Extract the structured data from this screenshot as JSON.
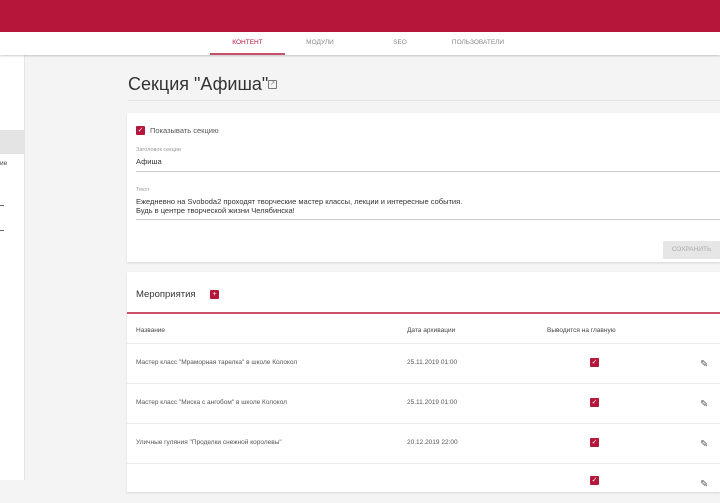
{
  "nav": {
    "tabs": [
      {
        "label": "КОНТЕНТ",
        "active": true
      },
      {
        "label": "МОДУЛИ"
      },
      {
        "label": "SEO"
      },
      {
        "label": "ПОЛЬЗОВАТЕЛИ"
      }
    ]
  },
  "sidebar": {
    "partial_label": "ие"
  },
  "page": {
    "title": "Секция \"Афиша\""
  },
  "section_form": {
    "show_section_label": "Показывать секцию",
    "show_section_checked": true,
    "title_label": "Заголовок секции",
    "title_value": "Афиша",
    "text_label": "Текст",
    "text_line1": "Ежедневно на Svoboda2 проходят творческие мастер классы, лекции и интересные события.",
    "text_line2": "Будь в центре творческой жизни Челябинска!",
    "save_label": "СОХРАНИТЬ"
  },
  "events": {
    "title": "Мероприятия",
    "columns": [
      "Название",
      "Дата архивации",
      "Выводится на главную"
    ],
    "rows": [
      {
        "name": "Мастер класс \"Мраморная тарелка\" в школе Колокол",
        "date": "25.11.2019 01:00",
        "on_main": true
      },
      {
        "name": "Мастер класс \"Миска с ангобом\" в школе Колокол",
        "date": "25.11.2019 01:00",
        "on_main": true
      },
      {
        "name": "Уличные гуляния \"Проделки снежной королевы\"",
        "date": "20.12.2019 22:00",
        "on_main": true
      },
      {
        "name": "",
        "date": "",
        "on_main": true
      }
    ]
  },
  "colors": {
    "accent": "#b5173a"
  }
}
